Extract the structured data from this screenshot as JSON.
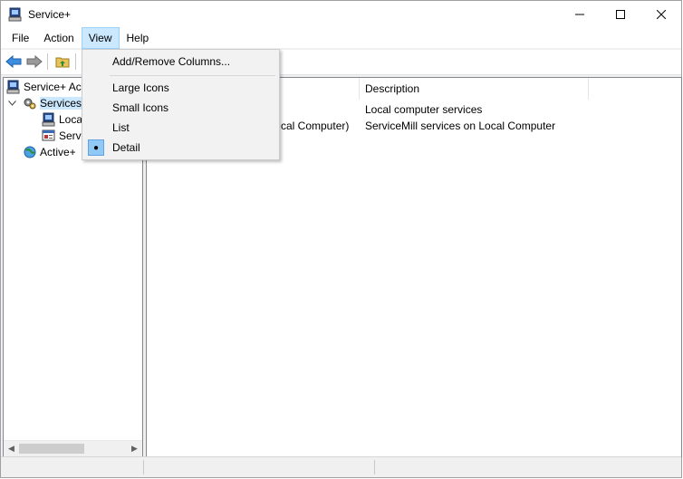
{
  "window": {
    "title": "Service+"
  },
  "menubar": {
    "items": [
      "File",
      "Action",
      "View",
      "Help"
    ],
    "active": "View"
  },
  "tree": {
    "root_label": "Service+ Ac",
    "services_label": "Services",
    "local_label": "Loca",
    "servicemill_label": "Serv",
    "active_label": "Active+"
  },
  "list": {
    "columns": {
      "name": "",
      "description": "Description"
    },
    "rows": [
      {
        "name": "",
        "description": "Local computer services"
      },
      {
        "name": "cal Computer)",
        "description": "ServiceMill services on Local Computer"
      }
    ]
  },
  "view_menu": {
    "add_remove_columns": "Add/Remove Columns...",
    "large_icons": "Large Icons",
    "small_icons": "Small Icons",
    "list": "List",
    "detail": "Detail",
    "selected": "Detail"
  },
  "colors": {
    "highlight": "#cce8ff",
    "selected_bullet_bg": "#90c8f6",
    "window_bg": "#f0f0f0"
  },
  "icons": [
    "app-computer-icon",
    "back-arrow-icon",
    "forward-arrow-icon",
    "folder-up-icon",
    "gear-icon",
    "computer-icon",
    "network-globe-icon"
  ]
}
